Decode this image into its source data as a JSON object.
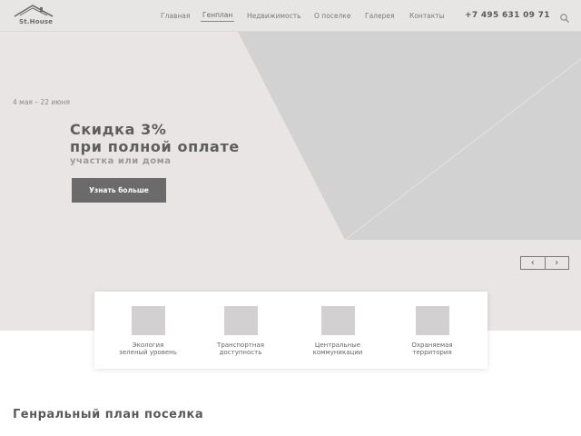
{
  "header": {
    "logo_text": "St.House",
    "nav": [
      {
        "label": "Главная",
        "active": false
      },
      {
        "label": "Генплан",
        "active": true
      },
      {
        "label": "Недвижимость",
        "active": false
      },
      {
        "label": "О поселке",
        "active": false
      },
      {
        "label": "Галерея",
        "active": false
      },
      {
        "label": "Контакты",
        "active": false
      }
    ],
    "phone": "+7 495 631 09 71",
    "search_icon": "search-icon"
  },
  "hero": {
    "date": "4 мая – 22 июня",
    "title_line1": "Скидка 3%",
    "title_line2": "при полной оплате",
    "subtitle": "участка или дома",
    "button_label": "Узнать больше",
    "prev_icon": "‹",
    "next_icon": "›"
  },
  "features": [
    {
      "line1": "Экология",
      "line2": "зеленый уровень"
    },
    {
      "line1": "Транспортная",
      "line2": "доступность"
    },
    {
      "line1": "Центральные",
      "line2": "коммуникации"
    },
    {
      "line1": "Охраняемая",
      "line2": "территория"
    }
  ],
  "section": {
    "title": "Генральный план поселка"
  },
  "colors": {
    "header_bg": "#e8e6e5",
    "hero_bg": "#e8e5e4",
    "hero_shape": "#d3d2d2",
    "button_bg": "#6b6b6b",
    "icon_placeholder": "#d2d0d0"
  }
}
